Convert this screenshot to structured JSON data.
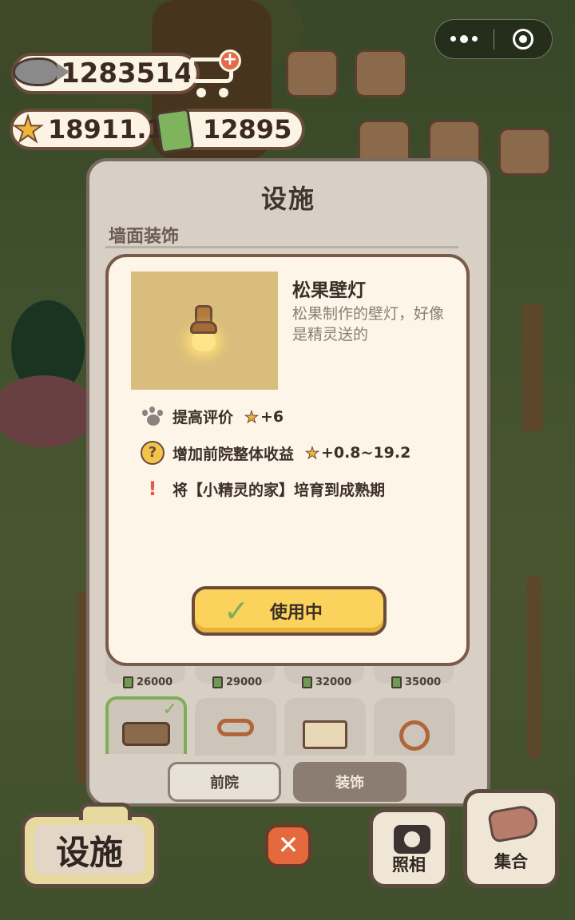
{
  "hud": {
    "fish_count": "1283514",
    "star_count": "18911.1",
    "cash_count": "12895",
    "fish_icon": "fish-icon",
    "star_icon": "star-icon",
    "cash_icon": "cash-icon",
    "shop_icon": "cart-plus-icon"
  },
  "panel": {
    "title": "设施",
    "subtitle": "墙面装饰",
    "grid_prices": [
      "26000",
      "29000",
      "32000",
      "35000"
    ],
    "tabs": [
      {
        "label": "前院",
        "active": false
      },
      {
        "label": "装饰",
        "active": true
      }
    ]
  },
  "popup": {
    "item_name": "松果壁灯",
    "item_description": "松果制作的壁灯，好像是精灵送的",
    "effects": [
      {
        "icon": "paw-icon",
        "label": "提高评价",
        "value": "+6"
      },
      {
        "icon": "question-icon",
        "label": "增加前院整体收益",
        "value": "+0.8~19.2"
      },
      {
        "icon": "exclamation-icon",
        "label": "将【小精灵的家】培育到成熟期",
        "value": ""
      }
    ],
    "use_button_label": "使用中"
  },
  "bottom": {
    "facility_label": "设施",
    "photo_label": "照相",
    "gather_label": "集合",
    "close_symbol": "✕"
  },
  "colors": {
    "accent_yellow": "#fbd35c",
    "border_brown": "#6b4b39",
    "check_green": "#7fae57",
    "close_orange": "#e46a3e"
  }
}
